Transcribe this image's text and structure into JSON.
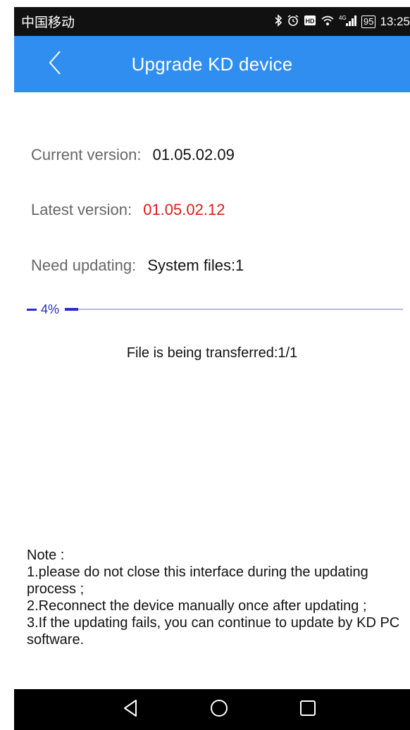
{
  "status_bar": {
    "carrier": "中国移动",
    "network": "4G",
    "battery": "95",
    "time": "13:25"
  },
  "header": {
    "title": "Upgrade KD device",
    "back_icon": "chevron-left-icon",
    "background_color": "#2f8ef0"
  },
  "info": {
    "current_version_label": "Current version:",
    "current_version_value": "01.05.02.09",
    "latest_version_label": "Latest version:",
    "latest_version_value": "01.05.02.12",
    "latest_version_color": "#e01b1b",
    "need_updating_label": "Need updating:",
    "need_updating_value": "System files:1"
  },
  "progress": {
    "percent_label": "4%",
    "value": 0.04,
    "accent_color": "#2a2ad0"
  },
  "transfer_status": "File is being transferred:1/1",
  "note": {
    "title": "Note :",
    "items": [
      "1.please do not close this interface during the updating process ;",
      "2.Reconnect the device manually once after updating ;",
      "3.If the updating fails, you can continue to update by KD PC software."
    ]
  },
  "nav_bar": {
    "back_icon": "triangle-back-icon",
    "home_icon": "circle-home-icon",
    "recents_icon": "square-recents-icon"
  }
}
